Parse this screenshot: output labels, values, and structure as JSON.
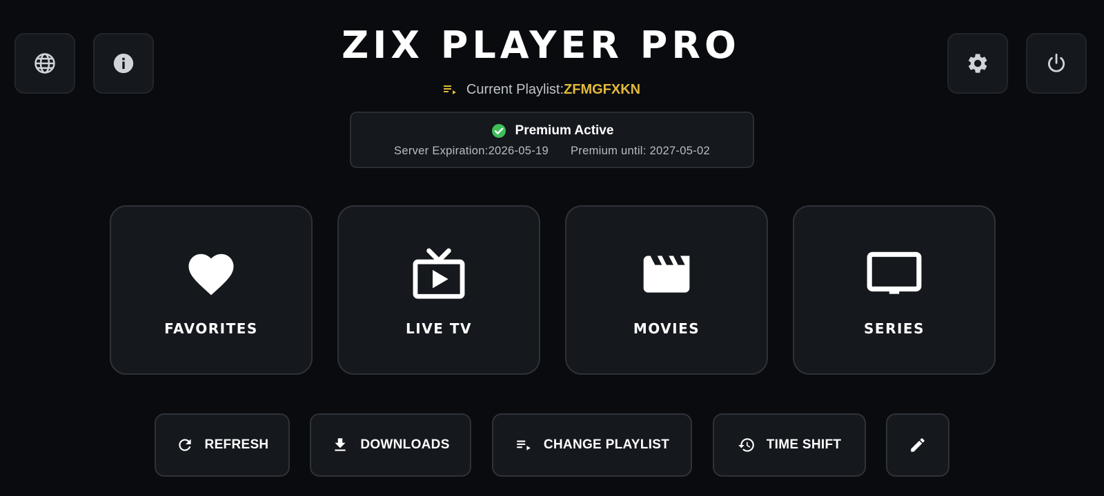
{
  "header": {
    "title": "ZIX PLAYER PRO",
    "playlist_prefix": "Current Playlist:",
    "playlist_name": "ZFMGFXKN"
  },
  "corner_buttons": {
    "language": "globe-icon",
    "info": "info-icon",
    "settings": "gear-icon",
    "power": "power-icon"
  },
  "status": {
    "title": "Premium Active",
    "server_expiration": "Server Expiration:2026-05-19",
    "premium_until": "Premium until: 2027-05-02"
  },
  "tiles": [
    {
      "label": "FAVORITES",
      "icon": "heart-icon"
    },
    {
      "label": "LIVE TV",
      "icon": "live-tv-icon"
    },
    {
      "label": "MOVIES",
      "icon": "clapperboard-icon"
    },
    {
      "label": "SERIES",
      "icon": "tv-screen-icon"
    }
  ],
  "actions": [
    {
      "label": "REFRESH",
      "icon": "refresh-icon"
    },
    {
      "label": "DOWNLOADS",
      "icon": "download-icon"
    },
    {
      "label": "CHANGE PLAYLIST",
      "icon": "playlist-icon"
    },
    {
      "label": "TIME SHIFT",
      "icon": "history-icon"
    },
    {
      "label": "",
      "icon": "pencil-icon"
    }
  ],
  "colors": {
    "background": "#090b0e",
    "panel": "#15181d",
    "accent": "#e2b93b",
    "success": "#3fbf5a",
    "icon_gray": "#d0d3d8"
  }
}
